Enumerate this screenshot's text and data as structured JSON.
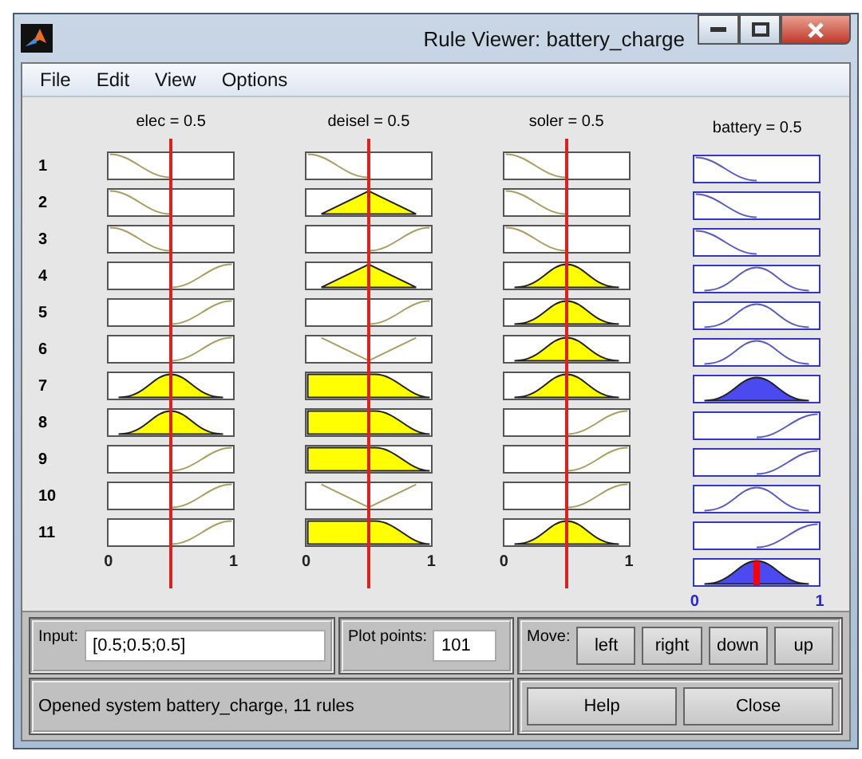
{
  "window": {
    "title": "Rule Viewer: battery_charge"
  },
  "menu": [
    "File",
    "Edit",
    "View",
    "Options"
  ],
  "inputs": [
    {
      "label": "elec = 0.5",
      "level": 0.5,
      "axis": [
        "0",
        "1"
      ]
    },
    {
      "label": "deisel = 0.5",
      "level": 0.5,
      "axis": [
        "0",
        "1"
      ]
    },
    {
      "label": "soler = 0.5",
      "level": 0.5,
      "axis": [
        "0",
        "1"
      ]
    }
  ],
  "output": {
    "label": "battery = 0.5",
    "level": 0.5,
    "kind": "gauss",
    "axis": [
      "0",
      "1"
    ]
  },
  "rules": [
    {
      "number": "1",
      "cells": [
        {
          "kind": "zlow",
          "fired": false
        },
        {
          "kind": "zlow",
          "fired": false
        },
        {
          "kind": "zlow",
          "fired": false
        },
        {
          "kind": "zlow",
          "fired": false
        }
      ]
    },
    {
      "number": "2",
      "cells": [
        {
          "kind": "zlow",
          "fired": false
        },
        {
          "kind": "tri",
          "fired": true
        },
        {
          "kind": "zlow",
          "fired": false
        },
        {
          "kind": "zlow",
          "fired": false
        }
      ]
    },
    {
      "number": "3",
      "cells": [
        {
          "kind": "zlow",
          "fired": false
        },
        {
          "kind": "shigh",
          "fired": false
        },
        {
          "kind": "zlow",
          "fired": false
        },
        {
          "kind": "zlow",
          "fired": false
        }
      ]
    },
    {
      "number": "4",
      "cells": [
        {
          "kind": "shigh",
          "fired": false
        },
        {
          "kind": "tri",
          "fired": true
        },
        {
          "kind": "gauss",
          "fired": true
        },
        {
          "kind": "gauss",
          "fired": false
        }
      ]
    },
    {
      "number": "5",
      "cells": [
        {
          "kind": "shigh",
          "fired": false
        },
        {
          "kind": "shigh",
          "fired": false
        },
        {
          "kind": "gauss",
          "fired": true
        },
        {
          "kind": "gauss",
          "fired": false
        }
      ]
    },
    {
      "number": "6",
      "cells": [
        {
          "kind": "shigh",
          "fired": false
        },
        {
          "kind": "vee",
          "fired": false
        },
        {
          "kind": "gauss",
          "fired": true
        },
        {
          "kind": "gauss",
          "fired": false
        }
      ]
    },
    {
      "number": "7",
      "cells": [
        {
          "kind": "gauss",
          "fired": true
        },
        {
          "kind": "trapz",
          "fired": true
        },
        {
          "kind": "gauss",
          "fired": true
        },
        {
          "kind": "gauss",
          "fired": true
        }
      ]
    },
    {
      "number": "8",
      "cells": [
        {
          "kind": "gauss",
          "fired": true
        },
        {
          "kind": "trapz",
          "fired": true
        },
        {
          "kind": "shigh",
          "fired": false
        },
        {
          "kind": "shigh",
          "fired": false
        }
      ]
    },
    {
      "number": "9",
      "cells": [
        {
          "kind": "shigh",
          "fired": false
        },
        {
          "kind": "trapz",
          "fired": true
        },
        {
          "kind": "shigh",
          "fired": false
        },
        {
          "kind": "shigh",
          "fired": false
        }
      ]
    },
    {
      "number": "10",
      "cells": [
        {
          "kind": "shigh",
          "fired": false
        },
        {
          "kind": "vee",
          "fired": false
        },
        {
          "kind": "shigh",
          "fired": false
        },
        {
          "kind": "gauss",
          "fired": false
        }
      ]
    },
    {
      "number": "11",
      "cells": [
        {
          "kind": "shigh",
          "fired": false
        },
        {
          "kind": "trapz",
          "fired": true
        },
        {
          "kind": "gauss",
          "fired": true
        },
        {
          "kind": "shigh",
          "fired": false
        }
      ]
    }
  ],
  "input_field": {
    "label": "Input:",
    "value": "[0.5;0.5;0.5]"
  },
  "plot_points": {
    "label": "Plot points:",
    "value": "101"
  },
  "move": {
    "label": "Move:",
    "buttons": [
      "left",
      "right",
      "down",
      "up"
    ]
  },
  "status": "Opened system battery_charge, 11 rules",
  "buttons": [
    "Help",
    "Close"
  ]
}
